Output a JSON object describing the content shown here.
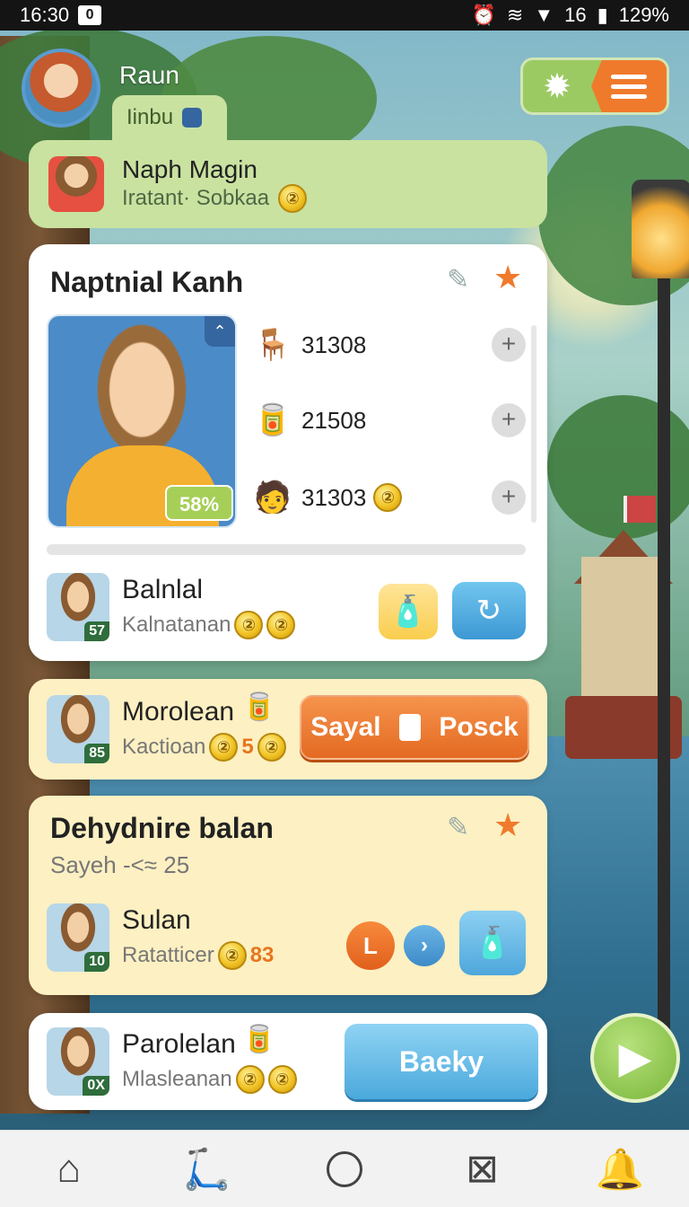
{
  "status_bar": {
    "time": "16:30",
    "notification_badge": "0",
    "battery": "129%",
    "network": "16"
  },
  "header": {
    "user_name": "Raun",
    "tab_label": "Iinbu"
  },
  "profile_card": {
    "title": "Naph Magin",
    "subtitle": "Iratant· Sobkaa",
    "coin_symbol": "②"
  },
  "main_card": {
    "title": "Naptnial Kanh",
    "portrait_badge": "58%",
    "resources": [
      {
        "icon": "stool-icon",
        "value": "31308"
      },
      {
        "icon": "canister-icon",
        "value": "21508"
      },
      {
        "icon": "character-icon",
        "value": "31303",
        "coin": true
      }
    ],
    "row": {
      "name": "Balnlal",
      "sub": "Kalnatanan",
      "level": "57"
    }
  },
  "moroleen_card": {
    "name": "Morolean",
    "sub": "Kactioan",
    "level": "85",
    "count": "5",
    "button_left": "Sayal",
    "button_right": "Posck"
  },
  "dehydnire_card": {
    "title": "Dehydnire balan",
    "subtitle": "Sayeh -<≈ 25",
    "row": {
      "name": "Sulan",
      "sub": "Ratatticer",
      "level": "10",
      "count": "83"
    },
    "circle_button": "L",
    "next_button": "›"
  },
  "parolelan_card": {
    "name": "Parolelan",
    "sub": "Mlasleanan",
    "level": "0X",
    "button": "Baeky"
  },
  "colors": {
    "accent_orange": "#f07a2c",
    "accent_green": "#9cca62",
    "accent_blue": "#4ba9dc",
    "card_yellow": "#fdf0c2",
    "card_green": "#c9e2a0"
  },
  "nav": [
    {
      "name": "home-icon"
    },
    {
      "name": "scooter-icon"
    },
    {
      "name": "circle-icon"
    },
    {
      "name": "board-icon"
    },
    {
      "name": "bell-icon"
    }
  ]
}
